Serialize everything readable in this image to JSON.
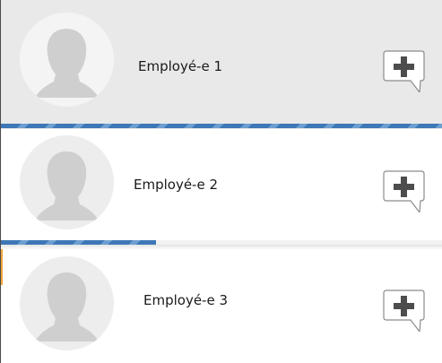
{
  "employees": [
    {
      "name": "Employé-e 1",
      "progress": 1.0,
      "selected": true
    },
    {
      "name": "Employé-e 2",
      "progress": 0.35,
      "selected": false
    },
    {
      "name": "Employé-e 3",
      "progress": null,
      "selected": false
    }
  ],
  "icons": {
    "avatar": "person-silhouette-icon",
    "comment": "comment-plus-icon"
  },
  "colors": {
    "selected_row": "#e9e9e9",
    "progress": "#3d77b6",
    "progress_stripe": "#6d9fd1",
    "accent": "#f2a33a",
    "icon_plus": "#4d4d4d"
  }
}
